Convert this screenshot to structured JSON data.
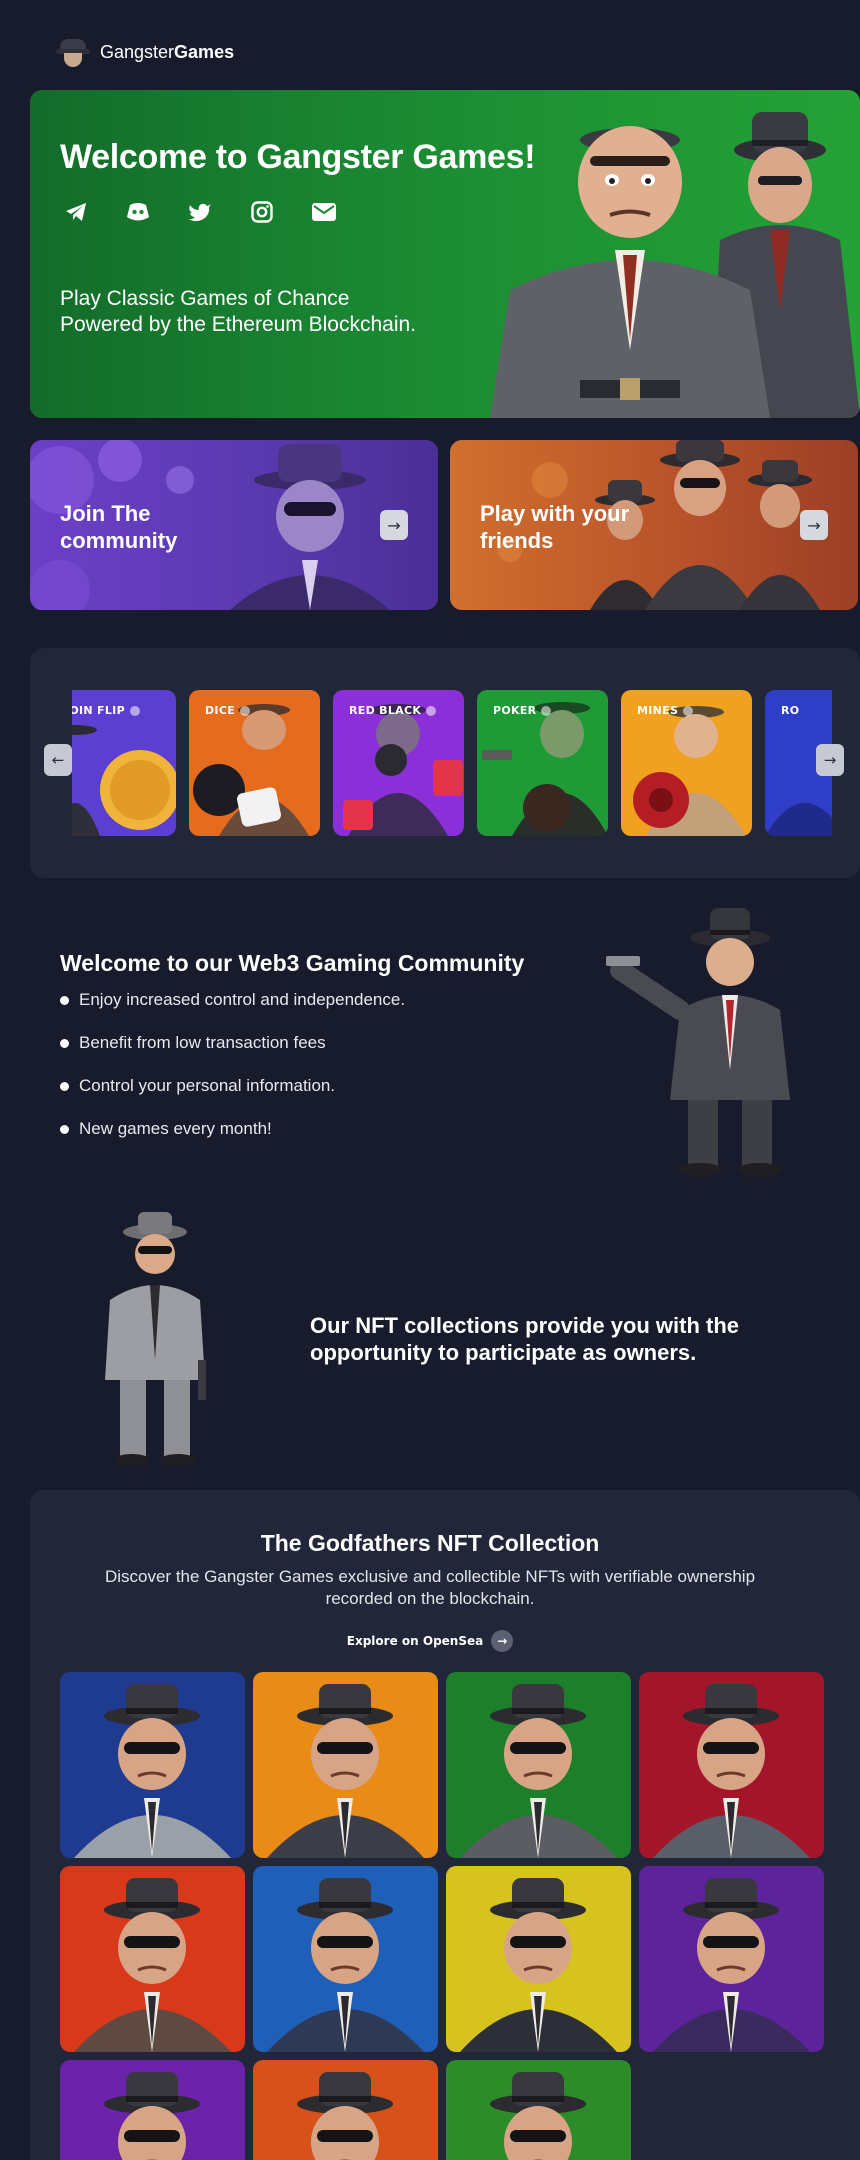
{
  "brand": {
    "name_light": "Gangster",
    "name_bold": "Games"
  },
  "hero": {
    "title": "Welcome to Gangster Games!",
    "tagline": "Play Classic Games of Chance Powered by the Ethereum Blockchain.",
    "socials": [
      {
        "icon": "telegram-icon"
      },
      {
        "icon": "discord-icon"
      },
      {
        "icon": "twitter-icon"
      },
      {
        "icon": "instagram-icon"
      },
      {
        "icon": "mail-icon"
      }
    ],
    "gradient": [
      "#136c2a",
      "#24a236"
    ]
  },
  "promos": [
    {
      "label": "Join The community",
      "color": "#6c3fc7"
    },
    {
      "label": "Play with your friends",
      "color": "#d0702e"
    }
  ],
  "games": [
    {
      "label": "COIN FLIP",
      "color": "#5b3fd1"
    },
    {
      "label": "DICE",
      "color": "#e56b1f"
    },
    {
      "label": "RED BLACK",
      "color": "#8b2fd8"
    },
    {
      "label": "POKER",
      "color": "#1f9a37"
    },
    {
      "label": "MINES",
      "color": "#f0a11f"
    },
    {
      "label": "RO",
      "color": "#2f3ec7"
    }
  ],
  "community": {
    "title": "Welcome to our Web3 Gaming Community",
    "items": [
      "Enjoy increased control and independence.",
      "Benefit from low transaction fees",
      "Control your personal information.",
      "New games every month!"
    ]
  },
  "owners": {
    "text": "Our NFT collections provide you with the opportunity to participate as owners."
  },
  "collection": {
    "title": "The Godfathers NFT Collection",
    "description": "Discover the Gangster Games exclusive and collectible NFTs with verifiable ownership recorded on the blockchain.",
    "cta": "Explore on OpenSea",
    "nfts": [
      {
        "bg": "#1f3b8f",
        "suit": "#9aa0a8"
      },
      {
        "bg": "#e98c17",
        "suit": "#3b3e48"
      },
      {
        "bg": "#1e7f2a",
        "suit": "#5b5d63"
      },
      {
        "bg": "#a3162a",
        "suit": "#5a5e68"
      },
      {
        "bg": "#d8391b",
        "suit": "#5e4a40"
      },
      {
        "bg": "#1f5fb8",
        "suit": "#2e3a55"
      },
      {
        "bg": "#d6c31d",
        "suit": "#2c2f38"
      },
      {
        "bg": "#5d239a",
        "suit": "#3a2a5e"
      },
      {
        "bg": "#6a22a8",
        "suit": "#8d8f96"
      },
      {
        "bg": "#d6521a",
        "suit": "#4a3a34"
      },
      {
        "bg": "#2e8b2a",
        "suit": "#5b3a2f"
      }
    ]
  }
}
